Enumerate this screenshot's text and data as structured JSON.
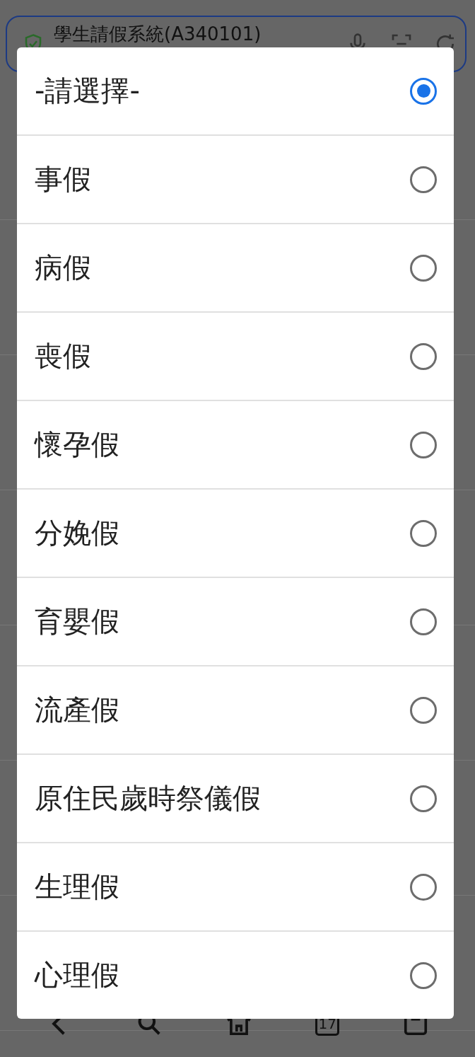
{
  "address_bar": {
    "title": "學生請假系統(A340101)"
  },
  "dialog": {
    "options": [
      {
        "label": "-請選擇-",
        "selected": true
      },
      {
        "label": "事假",
        "selected": false
      },
      {
        "label": "病假",
        "selected": false
      },
      {
        "label": "喪假",
        "selected": false
      },
      {
        "label": "懷孕假",
        "selected": false
      },
      {
        "label": "分娩假",
        "selected": false
      },
      {
        "label": "育嬰假",
        "selected": false
      },
      {
        "label": "流產假",
        "selected": false
      },
      {
        "label": "原住民歲時祭儀假",
        "selected": false
      },
      {
        "label": "生理假",
        "selected": false
      },
      {
        "label": "心理假",
        "selected": false
      }
    ]
  },
  "bottom_nav": {
    "calendar_day": "17"
  }
}
